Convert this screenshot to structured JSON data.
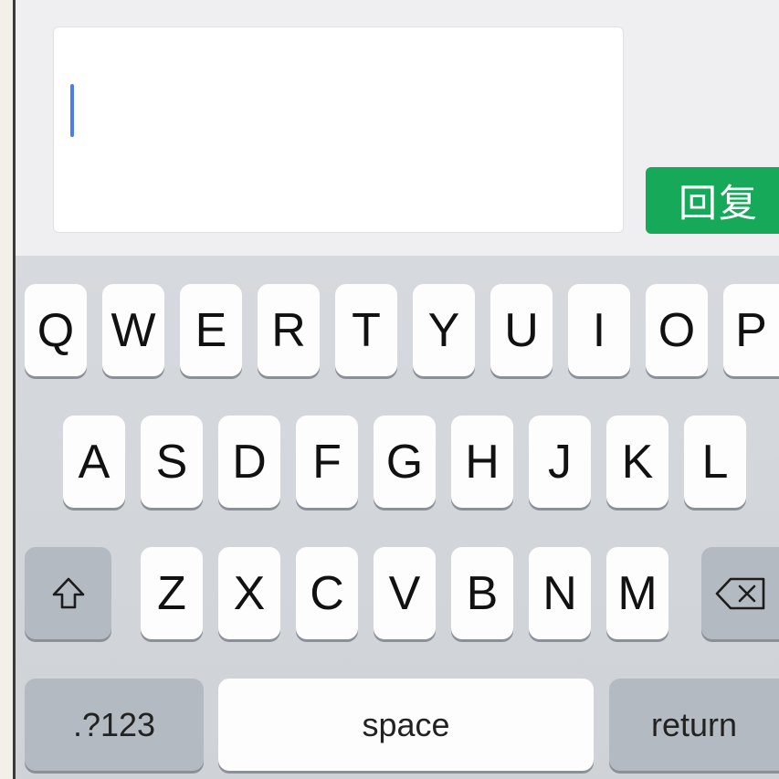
{
  "composer": {
    "reply_button_label": "回复"
  },
  "keyboard": {
    "row1": [
      "Q",
      "W",
      "E",
      "R",
      "T",
      "Y",
      "U",
      "I",
      "O",
      "P"
    ],
    "row2": [
      "A",
      "S",
      "D",
      "F",
      "G",
      "H",
      "J",
      "K",
      "L"
    ],
    "row3": [
      "Z",
      "X",
      "C",
      "V",
      "B",
      "N",
      "M"
    ],
    "shift_icon": "shift-arrow-icon",
    "delete_icon": "backspace-icon",
    "numbers_label": ".?123",
    "space_label": "space",
    "return_label": "return"
  },
  "colors": {
    "reply_button": "#17a95a",
    "caret": "#4c7cf5",
    "keyboard_bg": "#d3d6da",
    "special_key": "#b4bac2"
  }
}
